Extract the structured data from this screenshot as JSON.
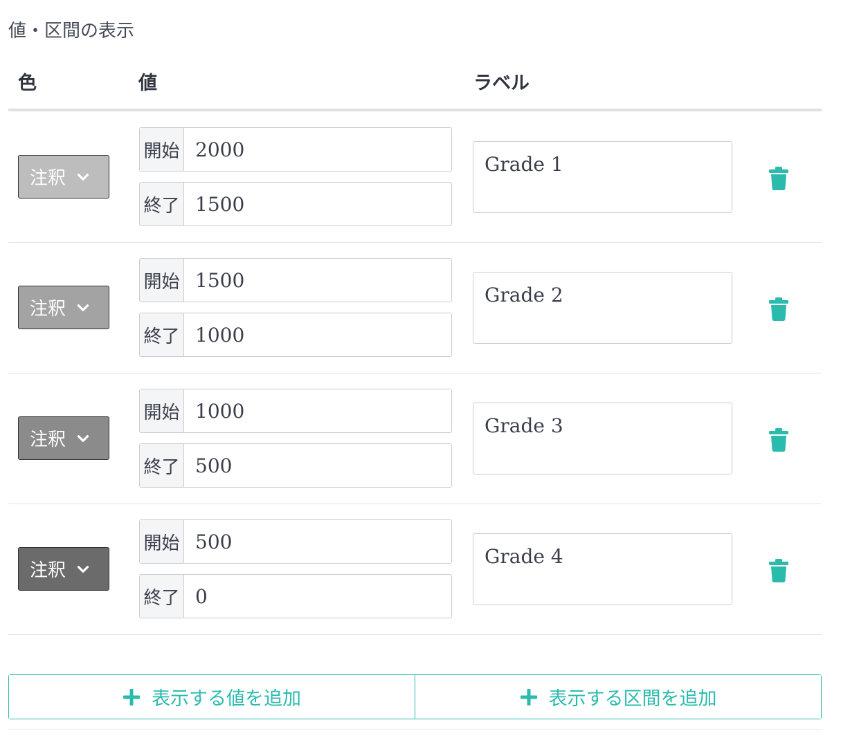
{
  "section_title": "値・区間の表示",
  "columns": {
    "color": "色",
    "value": "値",
    "label": "ラベル"
  },
  "addon_labels": {
    "start": "開始",
    "end": "終了"
  },
  "rows": [
    {
      "color_button": "注釈",
      "color": "#bdbdbd",
      "start": "2000",
      "end": "1500",
      "label": "Grade 1"
    },
    {
      "color_button": "注釈",
      "color": "#a3a3a3",
      "start": "1500",
      "end": "1000",
      "label": "Grade 2"
    },
    {
      "color_button": "注釈",
      "color": "#8b8b8b",
      "start": "1000",
      "end": "500",
      "label": "Grade 3"
    },
    {
      "color_button": "注釈",
      "color": "#6b6b6b",
      "start": "500",
      "end": "0",
      "label": "Grade 4"
    }
  ],
  "buttons": {
    "add_value": "表示する値を追加",
    "add_range": "表示する区間を追加"
  },
  "colors": {
    "accent": "#2bbbad"
  },
  "icons": {
    "chevron": "chevron-down-icon",
    "delete": "trash-icon",
    "add": "plus-icon"
  }
}
